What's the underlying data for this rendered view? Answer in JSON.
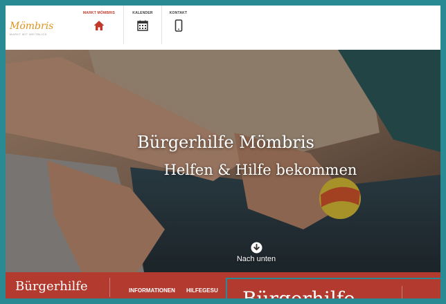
{
  "header": {
    "logo": {
      "text": "Mömbris",
      "tagline": "MARKT MIT WEITBLICK"
    },
    "nav": [
      {
        "label": "MARKT MÖMBRIS",
        "icon": "home-icon",
        "active": true
      },
      {
        "label": "KALENDER",
        "icon": "calendar-icon",
        "active": false
      },
      {
        "label": "KONTAKT",
        "icon": "mobile-phone-icon",
        "active": false
      }
    ]
  },
  "hero": {
    "title": "Bürgerhilfe Mömbris",
    "subtitle": "Helfen & Hilfe bekommen",
    "scroll_label": "Nach unten",
    "scroll_icon": "arrow-down-circle-icon"
  },
  "section_bar": {
    "title": "Bürgerhilfe",
    "nav": [
      "INFORMATIONEN",
      "HILFEGESU"
    ],
    "zoom_title": "Bürgerhilfe"
  },
  "colors": {
    "frame": "#2a8a93",
    "brand_orange": "#e0911c",
    "accent_red": "#c0392b",
    "bar_red": "#b23a2e"
  }
}
